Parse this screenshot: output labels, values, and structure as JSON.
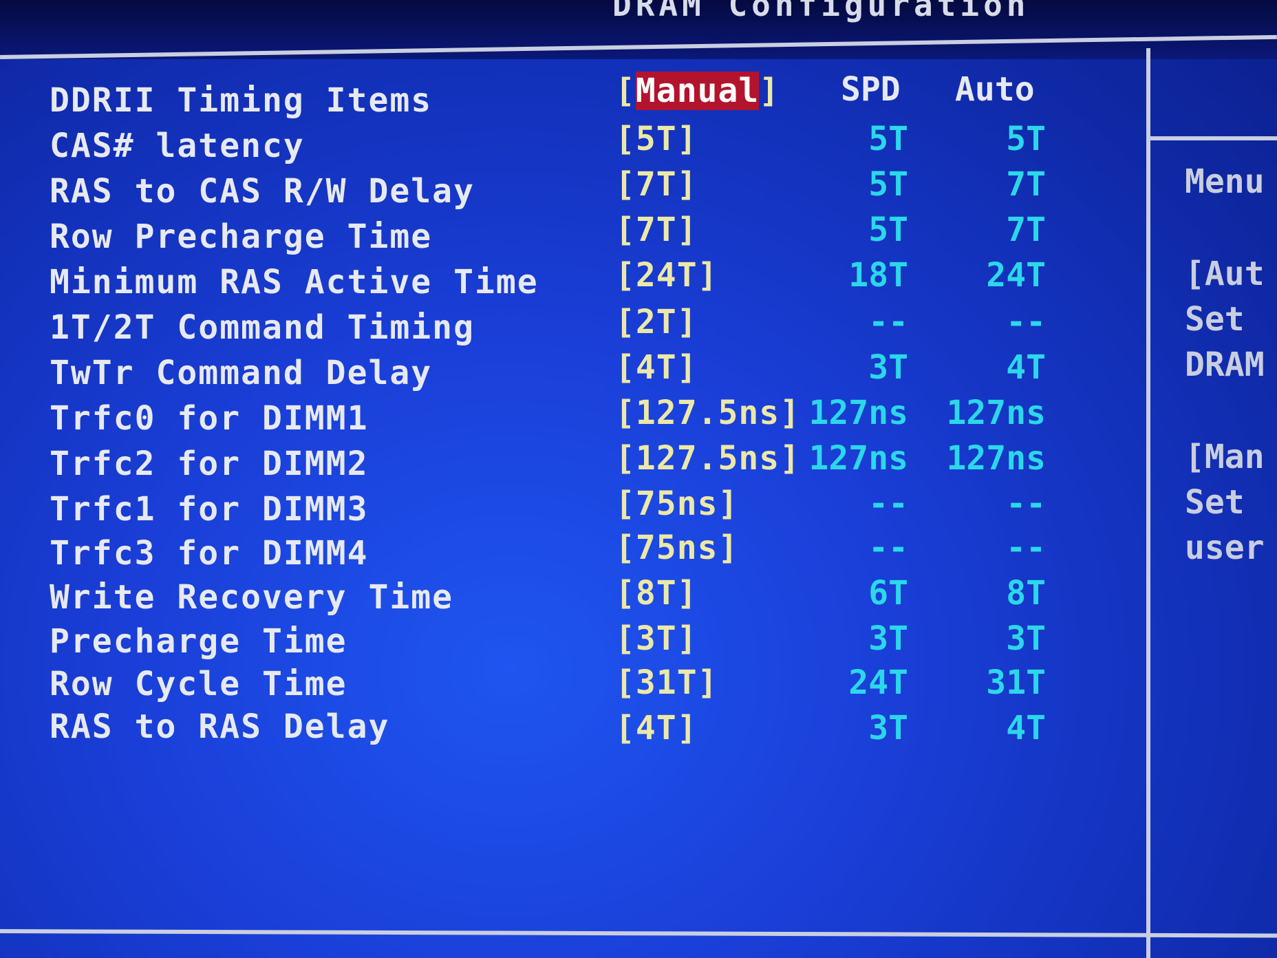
{
  "screen": {
    "title": "DRAM Configuration"
  },
  "columns": {
    "spd": "SPD",
    "auto": "Auto"
  },
  "rows": [
    {
      "label": "DDRII Timing Items",
      "bracket_open": "[",
      "selected": "Manual",
      "bracket_close": "]"
    },
    {
      "label": "CAS# latency",
      "value": "[5T]",
      "spd": "5T",
      "auto": "5T"
    },
    {
      "label": "RAS to CAS R/W Delay",
      "value": "[7T]",
      "spd": "5T",
      "auto": "7T"
    },
    {
      "label": "Row Precharge Time",
      "value": "[7T]",
      "spd": "5T",
      "auto": "7T"
    },
    {
      "label": "Minimum RAS Active Time",
      "value": "[24T]",
      "spd": "18T",
      "auto": "24T"
    },
    {
      "label": "1T/2T Command Timing",
      "value": "[2T]",
      "spd": "--",
      "auto": "--"
    },
    {
      "label": "TwTr Command Delay",
      "value": "[4T]",
      "spd": "3T",
      "auto": "4T"
    },
    {
      "label": "Trfc0 for DIMM1",
      "value": "[127.5ns]",
      "spd": "127ns",
      "auto": "127ns"
    },
    {
      "label": "Trfc2 for DIMM2",
      "value": "[127.5ns]",
      "spd": "127ns",
      "auto": "127ns"
    },
    {
      "label": "Trfc1 for DIMM3",
      "value": "[75ns]",
      "spd": "--",
      "auto": "--"
    },
    {
      "label": "Trfc3 for DIMM4",
      "value": "[75ns]",
      "spd": "--",
      "auto": "--"
    },
    {
      "label": "Write Recovery Time",
      "value": "[8T]",
      "spd": "6T",
      "auto": "8T"
    },
    {
      "label": "Precharge Time",
      "value": "[3T]",
      "spd": "3T",
      "auto": "3T"
    },
    {
      "label": "Row Cycle Time",
      "value": "[31T]",
      "spd": "24T",
      "auto": "31T"
    },
    {
      "label": "RAS to RAS Delay",
      "value": "[4T]",
      "spd": "3T",
      "auto": "4T"
    }
  ],
  "help_panel": {
    "lines": [
      "Menu",
      "[Aut",
      "Set",
      "DRAM",
      "[Man",
      "Set",
      "user"
    ]
  },
  "colors": {
    "background": "#1a3fd8",
    "label_text": "#e7e9f1",
    "value_text": "#ece8a8",
    "spd_auto_text": "#2bd7e9",
    "highlight": "#b3132c"
  }
}
